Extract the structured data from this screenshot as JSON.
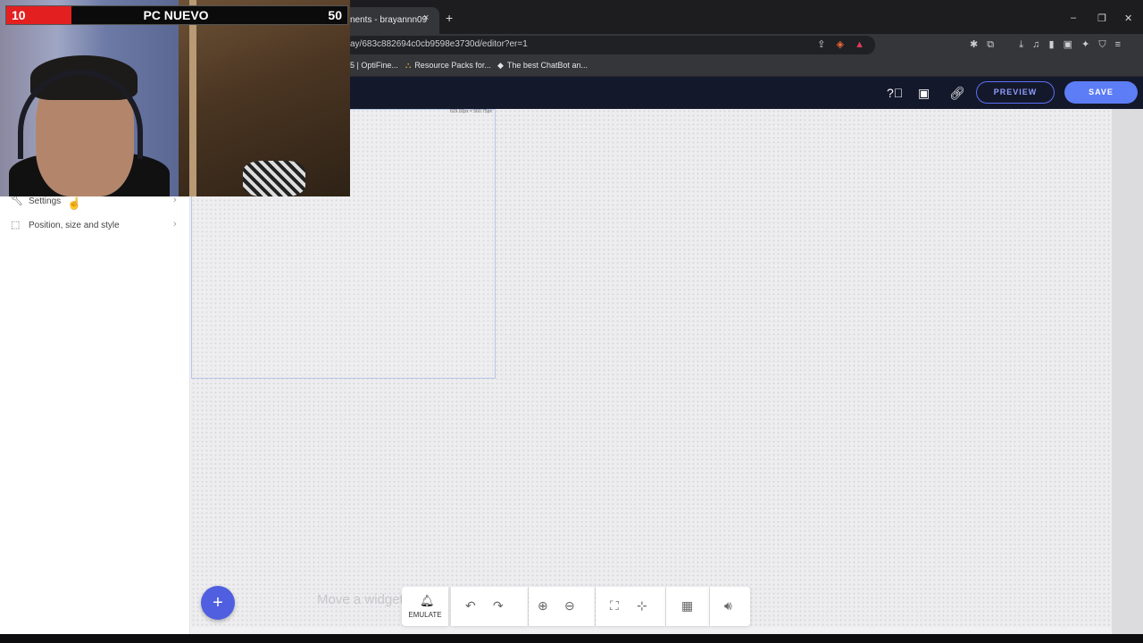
{
  "browser": {
    "tab_title": "nents - brayannn09",
    "tab_close": "×",
    "new_tab": "+",
    "url": "ay/683c882694c0cb9598e3730d/editor?er=1",
    "window_controls": {
      "minimize": "–",
      "maximize": "❐",
      "close": "✕"
    },
    "bookmarks": [
      {
        "label": "5 | OptiFine...",
        "icon": "bookmark-icon"
      },
      {
        "label": "Resource Packs for...",
        "icon": "resource-icon"
      },
      {
        "label": "The best ChatBot an...",
        "icon": "chatbot-icon"
      }
    ]
  },
  "header": {
    "preview_label": "PREVIEW",
    "save_label": "SAVE",
    "icons": [
      "help-icon",
      "monitor-icon",
      "link-icon"
    ]
  },
  "left_panel": {
    "items": [
      {
        "label": "Settings",
        "icon": "wrench-icon"
      },
      {
        "label": "Position, size and style",
        "icon": "dashed-box-icon"
      }
    ]
  },
  "canvas": {
    "dimensions_label": "629.02px × 560.75px",
    "hint": "Move a widget"
  },
  "bottom_toolbar": {
    "add_button": "+",
    "emulate_label": "EMULATE",
    "tools": [
      "undo-icon",
      "redo-icon",
      "zoom-in-icon",
      "zoom-out-icon",
      "fullscreen-icon",
      "exit-fullscreen-icon",
      "grid-icon",
      "volume-icon"
    ]
  },
  "stream_overlay": {
    "left_score": "10",
    "title": "PC NUEVO",
    "right_score": "50"
  },
  "colors": {
    "accent": "#5d7df6",
    "header_bg": "#14182b",
    "score_red": "#e41f1f"
  }
}
